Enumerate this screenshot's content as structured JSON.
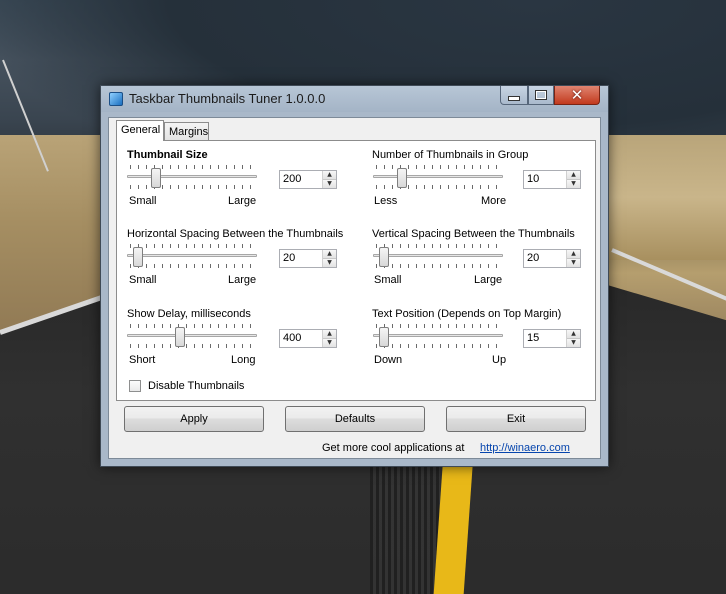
{
  "window": {
    "title": "Taskbar Thumbnails Tuner 1.0.0.0"
  },
  "tabs": [
    {
      "label": "General",
      "active": true
    },
    {
      "label": "Margins",
      "active": false
    }
  ],
  "settings": {
    "thumbnail_size": {
      "label": "Thumbnail Size",
      "value": "200",
      "min_label": "Small",
      "max_label": "Large",
      "slider_level": 0.2
    },
    "thumbnails_in_group": {
      "label": "Number of Thumbnails in Group",
      "value": "10",
      "min_label": "Less",
      "max_label": "More",
      "slider_level": 0.2
    },
    "horizontal_spacing": {
      "label": "Horizontal Spacing Between the Thumbnails",
      "value": "20",
      "min_label": "Small",
      "max_label": "Large",
      "slider_level": 0.05
    },
    "vertical_spacing": {
      "label": "Vertical Spacing Between the Thumbnails",
      "value": "20",
      "min_label": "Small",
      "max_label": "Large",
      "slider_level": 0.05
    },
    "show_delay": {
      "label": "Show Delay, milliseconds",
      "value": "400",
      "min_label": "Short",
      "max_label": "Long",
      "slider_level": 0.4
    },
    "text_position": {
      "label": "Text Position (Depends on Top Margin)",
      "value": "15",
      "min_label": "Down",
      "max_label": "Up",
      "slider_level": 0.05
    }
  },
  "disable_thumbnails": {
    "label": "Disable Thumbnails",
    "checked": false
  },
  "buttons": {
    "apply": "Apply",
    "defaults": "Defaults",
    "exit": "Exit"
  },
  "footer": {
    "text": "Get more cool applications at",
    "link": "http://winaero.com"
  }
}
